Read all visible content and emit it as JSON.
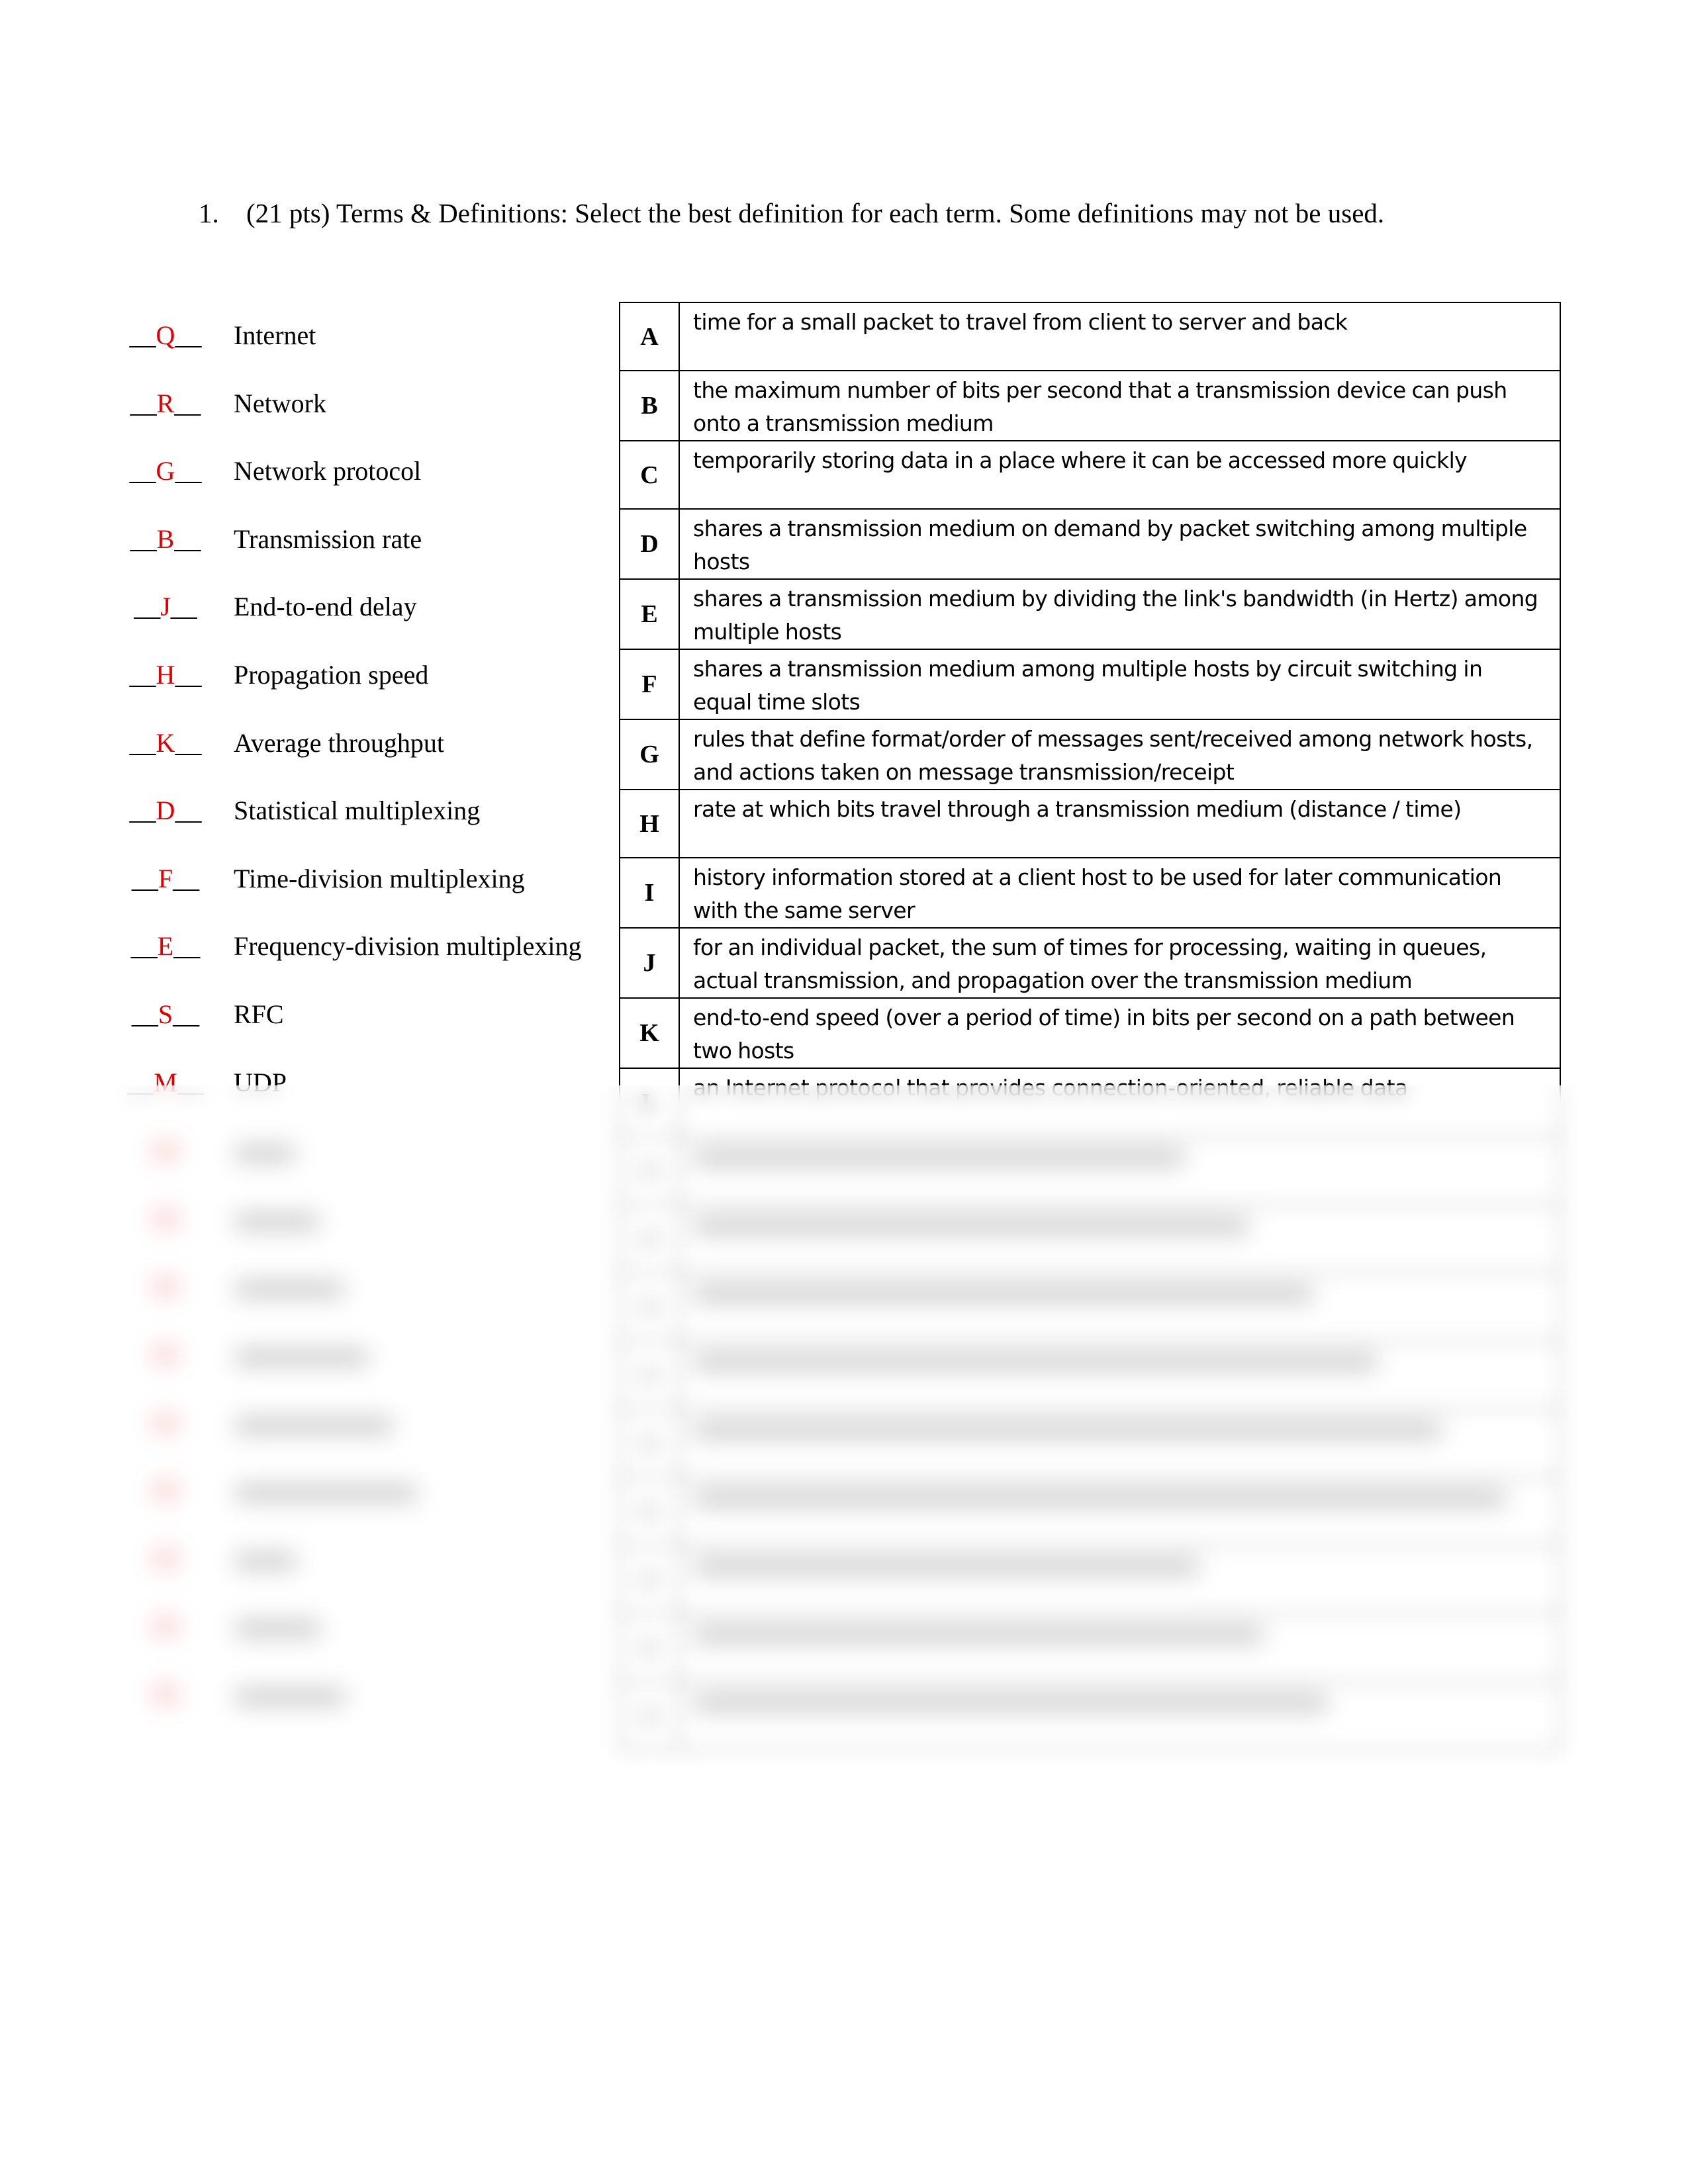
{
  "question": {
    "number": "1.",
    "text": "(21 pts) Terms & Definitions: Select the best definition for each term.  Some definitions may not be used."
  },
  "colors": {
    "answer": "#e00000",
    "text": "#000000"
  },
  "terms": [
    {
      "answer": "Q",
      "label": "Internet"
    },
    {
      "answer": "R",
      "label": "Network"
    },
    {
      "answer": "G",
      "label": "Network protocol"
    },
    {
      "answer": "B",
      "label": "Transmission rate"
    },
    {
      "answer": "J",
      "label": "End-to-end delay"
    },
    {
      "answer": "H",
      "label": "Propagation speed"
    },
    {
      "answer": "K",
      "label": "Average throughput"
    },
    {
      "answer": "D",
      "label": "Statistical multiplexing"
    },
    {
      "answer": "F",
      "label": "Time-division multiplexing"
    },
    {
      "answer": "E",
      "label": "Frequency-division multiplexing"
    },
    {
      "answer": "S",
      "label": "RFC"
    },
    {
      "answer": "M",
      "label": "UDP"
    }
  ],
  "blank_underscores": "__",
  "definitions": [
    {
      "letter": "A",
      "text": "time for a small packet to travel from client to server and back"
    },
    {
      "letter": "B",
      "text": "the maximum number of bits per second that a transmission device can push onto a transmission medium"
    },
    {
      "letter": "C",
      "text": "temporarily storing data in a place where it can be accessed more quickly"
    },
    {
      "letter": "D",
      "text": "shares a transmission medium on demand by packet switching among multiple hosts"
    },
    {
      "letter": "E",
      "text": "shares a transmission medium by dividing the link's bandwidth (in Hertz) among multiple hosts"
    },
    {
      "letter": "F",
      "text": "shares a transmission medium among multiple hosts by circuit switching in equal time slots"
    },
    {
      "letter": "G",
      "text": "rules that define format/order of messages sent/received among network hosts, and actions taken on message transmission/receipt"
    },
    {
      "letter": "H",
      "text": "rate at which bits travel through a transmission medium (distance / time)"
    },
    {
      "letter": "I",
      "text": "history information stored at a client host to be used for later communication with the same server"
    },
    {
      "letter": "J",
      "text": "for an individual packet, the sum of times for processing, waiting in queues, actual transmission, and propagation over the transmission medium"
    },
    {
      "letter": "K",
      "text": "end-to-end speed (over a period of time) in bits per second on a path between two hosts"
    },
    {
      "letter": "L",
      "text": "an Internet protocol that provides connection-oriented, reliable data"
    }
  ]
}
